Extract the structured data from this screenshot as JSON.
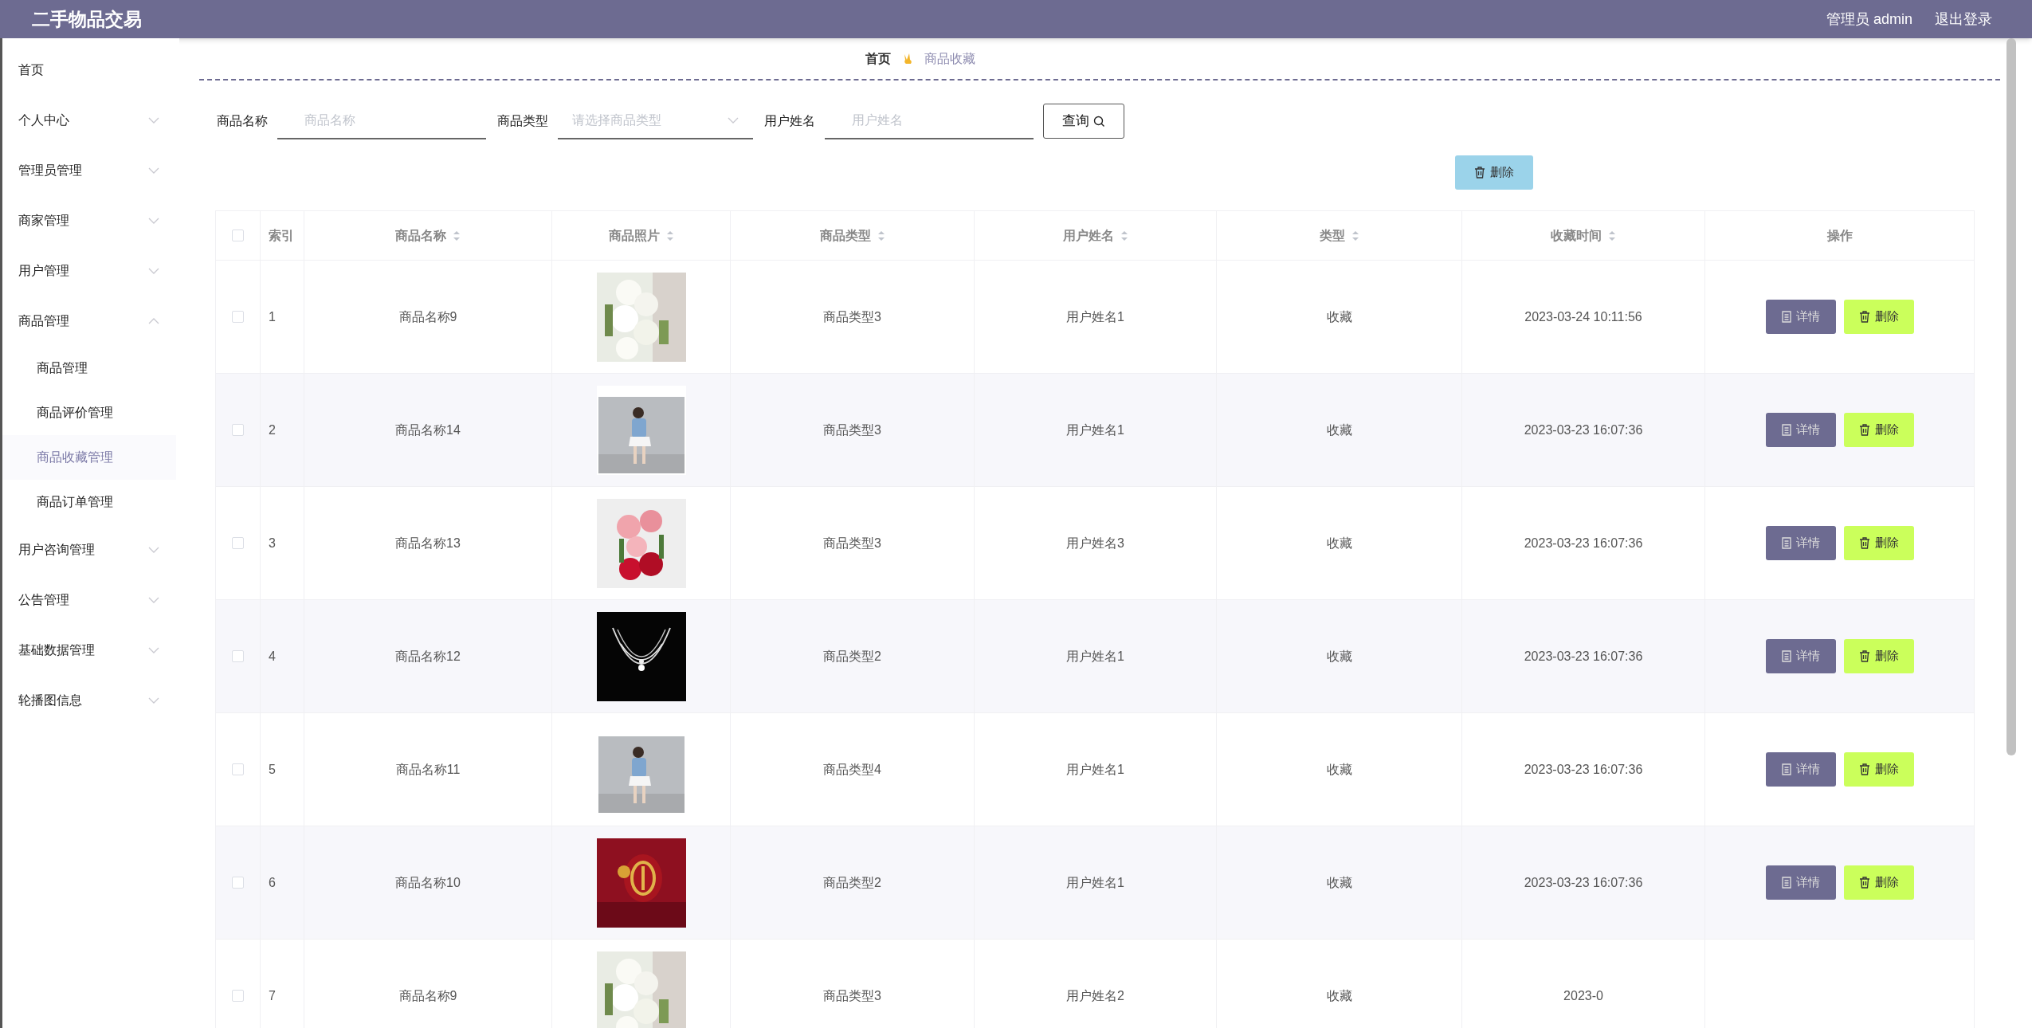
{
  "app_title": "二手物品交易",
  "header": {
    "user": "管理员 admin",
    "logout": "退出登录"
  },
  "sidebar": {
    "items": [
      {
        "label": "首页",
        "has_caret": false
      },
      {
        "label": "个人中心",
        "expanded": false,
        "has_caret": true
      },
      {
        "label": "管理员管理",
        "expanded": false,
        "has_caret": true
      },
      {
        "label": "商家管理",
        "expanded": false,
        "has_caret": true
      },
      {
        "label": "用户管理",
        "expanded": false,
        "has_caret": true
      },
      {
        "label": "商品管理",
        "expanded": true,
        "has_caret": true,
        "children": [
          {
            "label": "商品管理",
            "selected": false
          },
          {
            "label": "商品评价管理",
            "selected": false
          },
          {
            "label": "商品收藏管理",
            "selected": true
          },
          {
            "label": "商品订单管理",
            "selected": false
          }
        ]
      },
      {
        "label": "用户咨询管理",
        "expanded": false,
        "has_caret": true
      },
      {
        "label": "公告管理",
        "expanded": false,
        "has_caret": true
      },
      {
        "label": "基础数据管理",
        "expanded": false,
        "has_caret": true
      },
      {
        "label": "轮播图信息",
        "expanded": false,
        "has_caret": true
      }
    ]
  },
  "breadcrumb": {
    "home": "首页",
    "current": "商品收藏"
  },
  "filters": [
    {
      "kind": "text",
      "label": "商品名称",
      "placeholder": "商品名称"
    },
    {
      "kind": "select",
      "label": "商品类型",
      "placeholder": "请选择商品类型"
    },
    {
      "kind": "text",
      "label": "用户姓名",
      "placeholder": "用户姓名"
    }
  ],
  "search_button": "查询",
  "delete_button": "删除",
  "table": {
    "select_all_checked": false,
    "columns": [
      {
        "label": "索引",
        "sortable": false
      },
      {
        "label": "商品名称",
        "sortable": true
      },
      {
        "label": "商品照片",
        "sortable": true
      },
      {
        "label": "商品类型",
        "sortable": true
      },
      {
        "label": "用户姓名",
        "sortable": true
      },
      {
        "label": "类型",
        "sortable": true
      },
      {
        "label": "收藏时间",
        "sortable": true
      },
      {
        "label": "操作",
        "sortable": false
      }
    ],
    "rows": [
      {
        "index": "1",
        "name": "商品名称9",
        "photo": {
          "kind": "picture"
        },
        "type": "商品类型3",
        "user": "用户姓名1",
        "kind": "收藏",
        "time": "2023-03-24 10:11:56",
        "checked": false,
        "actions": [
          "详情",
          "删除"
        ]
      },
      {
        "index": "2",
        "name": "商品名称14",
        "photo": {
          "kind": "picture"
        },
        "type": "商品类型3",
        "user": "用户姓名1",
        "kind": "收藏",
        "time": "2023-03-23 16:07:36",
        "checked": false,
        "actions": [
          "详情",
          "删除"
        ]
      },
      {
        "index": "3",
        "name": "商品名称13",
        "photo": {
          "kind": "picture"
        },
        "type": "商品类型3",
        "user": "用户姓名3",
        "kind": "收藏",
        "time": "2023-03-23 16:07:36",
        "checked": false,
        "actions": [
          "详情",
          "删除"
        ]
      },
      {
        "index": "4",
        "name": "商品名称12",
        "photo": {
          "kind": "picture"
        },
        "type": "商品类型2",
        "user": "用户姓名1",
        "kind": "收藏",
        "time": "2023-03-23 16:07:36",
        "checked": false,
        "actions": [
          "详情",
          "删除"
        ]
      },
      {
        "index": "5",
        "name": "商品名称11",
        "photo": {
          "kind": "picture"
        },
        "type": "商品类型4",
        "user": "用户姓名1",
        "kind": "收藏",
        "time": "2023-03-23 16:07:36",
        "checked": false,
        "actions": [
          "详情",
          "删除"
        ]
      },
      {
        "index": "6",
        "name": "商品名称10",
        "photo": {
          "kind": "picture"
        },
        "type": "商品类型2",
        "user": "用户姓名1",
        "kind": "收藏",
        "time": "2023-03-23 16:07:36",
        "checked": false,
        "actions": [
          "详情",
          "删除"
        ]
      },
      {
        "index": "7",
        "name": "商品名称9",
        "photo": {
          "kind": "picture"
        },
        "type": "商品类型3",
        "user": "用户姓名2",
        "kind": "收藏",
        "time": "2023-0",
        "checked": false,
        "actions": []
      }
    ]
  }
}
